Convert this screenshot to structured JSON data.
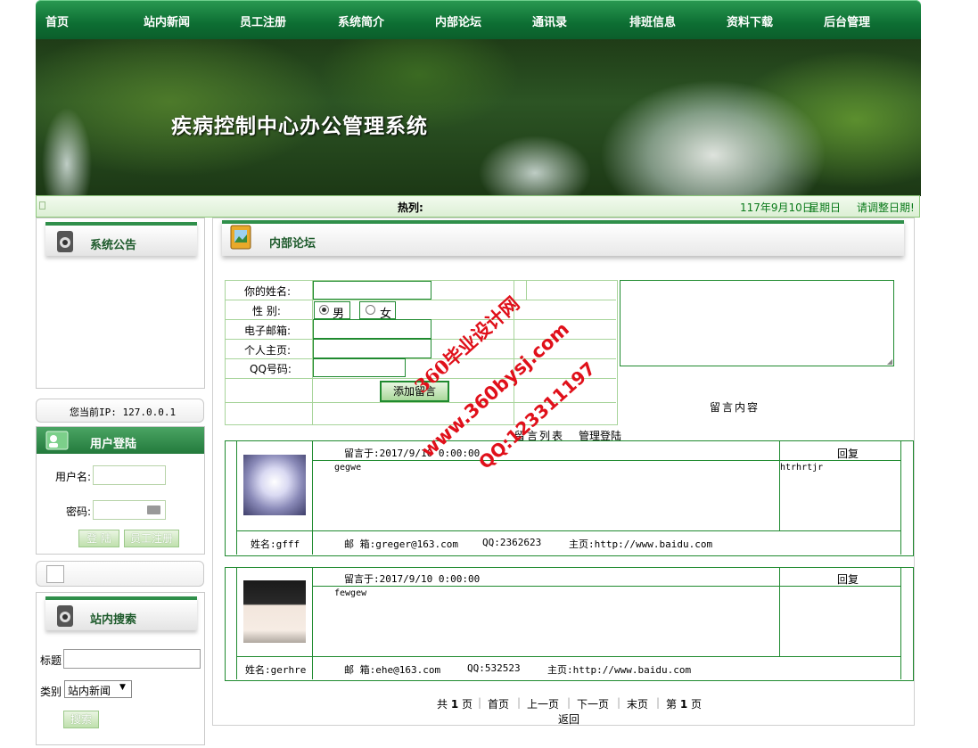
{
  "nav": {
    "items": [
      "首页",
      "站内新闻",
      "员工注册",
      "系统简介",
      "内部论坛",
      "通讯录",
      "排班信息",
      "资料下载",
      "后台管理"
    ]
  },
  "banner": {
    "title": "疾病控制中心办公管理系统"
  },
  "hotbar": {
    "label": "热列:",
    "date": "117年9月10日",
    "weekday": "星期日",
    "notice": "请调整日期!"
  },
  "left": {
    "announcement_title": "系统公告",
    "ip_text": "您当前IP: 127.0.0.1",
    "login": {
      "title": "用户登陆",
      "username_label": "用户名:",
      "password_label": "密码:",
      "login_button": "登 陆",
      "register_button": "员工注册"
    },
    "search": {
      "title": "站内搜索",
      "title_label": "标题",
      "category_label": "类别",
      "category_value": "站内新闻",
      "search_button": "搜索"
    }
  },
  "main": {
    "section_title": "内部论坛",
    "form": {
      "name_label": "你的姓名:",
      "gender_label": "性 别:",
      "gender_male": "男",
      "gender_female": "女",
      "gender_selected": "男",
      "email_label": "电子邮箱:",
      "homepage_label": "个人主页:",
      "qq_label": "QQ号码:",
      "submit_button": "添加留言",
      "content_label": "留言内容"
    },
    "links": {
      "list": "留言列表",
      "admin": "管理登陆"
    },
    "messages": [
      {
        "time": "留言于:2017/9/10 0:00:00",
        "reply_header": "回复",
        "content": "gegwe",
        "reply": "htrhrtjr",
        "name": "姓名:gfff",
        "email": "邮 箱:greger@163.com",
        "qq": "QQ:2362623",
        "homepage": "主页:http://www.baidu.com"
      },
      {
        "time": "留言于:2017/9/10 0:00:00",
        "reply_header": "回复",
        "content": "fewgew",
        "reply": "",
        "name": "姓名:gerhre",
        "email": "邮 箱:ehe@163.com",
        "qq": "QQ:532523",
        "homepage": "主页:http://www.baidu.com"
      }
    ],
    "pager": {
      "total_prefix": "共",
      "total_pages": "1",
      "total_suffix": "页",
      "first": "首页",
      "prev": "上一页",
      "next": "下一页",
      "last": "末页",
      "current_prefix": "第",
      "current_page": "1",
      "current_suffix": "页",
      "back": "返回"
    }
  },
  "watermark": {
    "line1": "360毕业设计网",
    "line2": "www.360bysj.com",
    "line3": "QQ:123311197"
  },
  "colors": {
    "nav_green": "#0d6e33",
    "border_green": "#1f8a2f",
    "watermark_red": "#e0101a"
  }
}
